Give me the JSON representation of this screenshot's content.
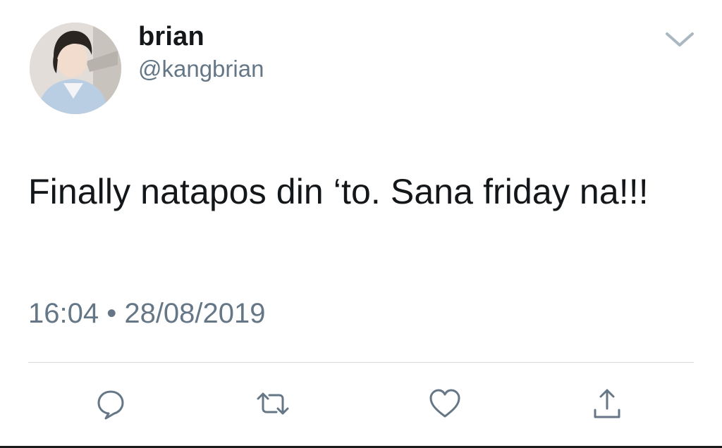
{
  "user": {
    "display_name": "brian",
    "handle": "@kangbrian"
  },
  "tweet": {
    "text": "Finally natapos din ‘to. Sana friday na!!!",
    "timestamp": "16:04 • 28/08/2019"
  },
  "icons": {
    "menu": "chevron-down-icon",
    "reply": "speech-bubble-icon",
    "retweet": "retweet-arrows-icon",
    "like": "heart-icon",
    "share": "share-upload-icon"
  },
  "colors": {
    "text_primary": "#14171a",
    "text_secondary": "#657786",
    "icon": "#657786",
    "divider": "#d4d9dd",
    "background": "#ffffff"
  }
}
